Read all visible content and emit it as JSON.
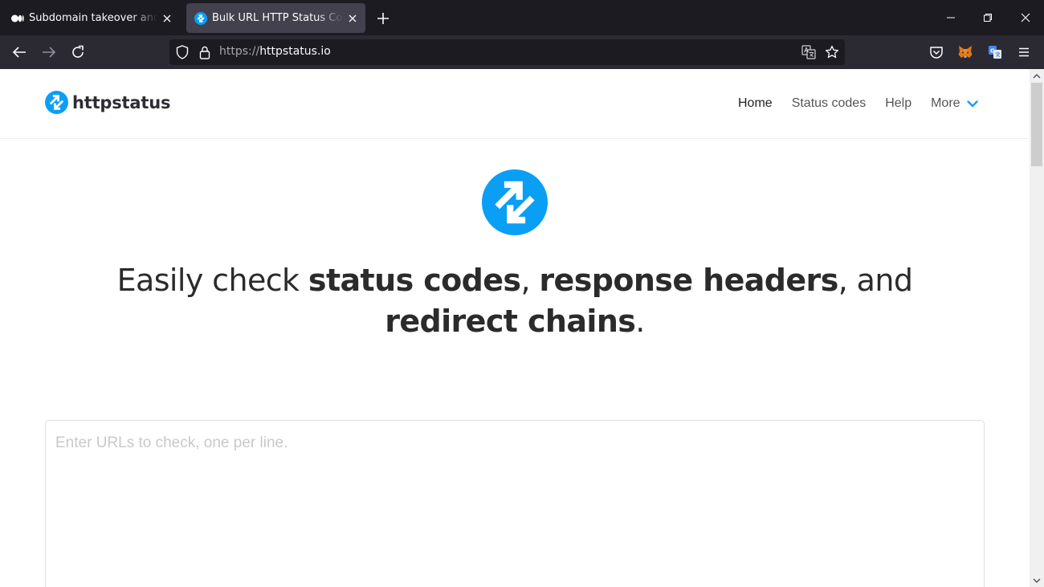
{
  "browser": {
    "tabs": [
      {
        "title": "Subdomain takeover and Text in",
        "favicon": "medium-icon",
        "active": false
      },
      {
        "title": "Bulk URL HTTP Status Code, Hea",
        "favicon": "httpstatus-icon",
        "active": true
      }
    ],
    "url": {
      "scheme": "https://",
      "host": "httpstatus.io"
    }
  },
  "site": {
    "brand": "httpstatus",
    "nav": {
      "home": "Home",
      "status_codes": "Status codes",
      "help": "Help",
      "more": "More"
    },
    "headline": {
      "part1": "Easily check ",
      "bold1": "status codes",
      "part2": ", ",
      "bold2": "response headers",
      "part3": ", and ",
      "bold3": "redirect chains",
      "part4": "."
    },
    "url_input": {
      "placeholder": "Enter URLs to check, one per line.",
      "value": ""
    }
  },
  "colors": {
    "brand_blue": "#0b9ef5",
    "chevron_blue": "#1a9bf0"
  }
}
